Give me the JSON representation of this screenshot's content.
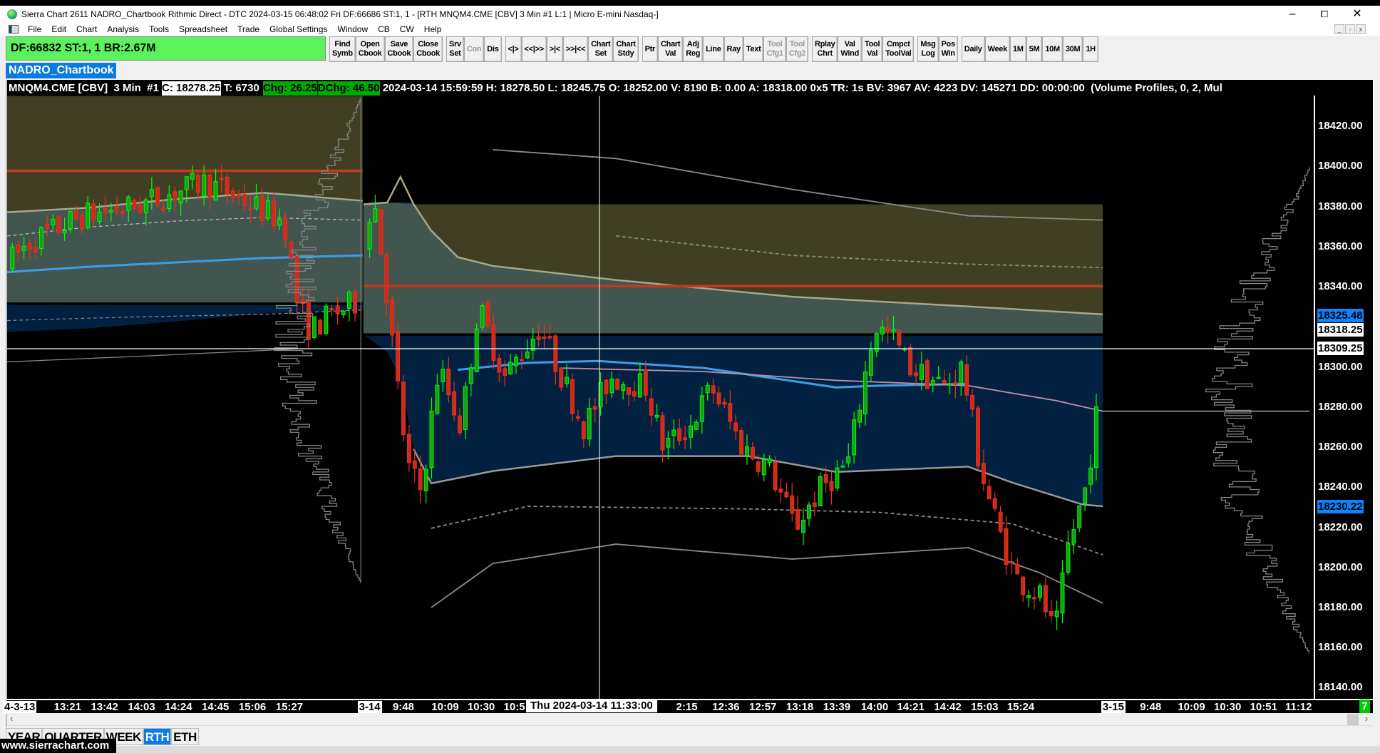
{
  "window": {
    "title": "Sierra Chart 2611 NADRO_Chartbook Rithmic Direct - DTC 2024-03-15  06:48:02 Fri DF:66686  ST:1, 1 - [RTH MNQM4.CME [CBV]  3 Min  #1 L:1 | Micro E-mini Nasdaq-]",
    "minimize": "–",
    "maximize": "⧠",
    "close": "✕"
  },
  "menu": [
    "File",
    "Edit",
    "Chart",
    "Analysis",
    "Tools",
    "Spreadsheet",
    "Trade",
    "Global Settings",
    "Window",
    "CB",
    "CW",
    "Help"
  ],
  "status_box": "DF:66832  ST:1, 1  BR:2.67M",
  "toolbar_groups": [
    [
      {
        "l": "Find\nSymb"
      },
      {
        "l": "Open\nCbook"
      },
      {
        "l": "Save\nCbook"
      },
      {
        "l": "Close\nCbook"
      }
    ],
    [
      {
        "l": "Srv\nSet"
      },
      {
        "l": "Con",
        "disabled": true
      },
      {
        "l": "Dis"
      }
    ],
    [
      {
        "l": "<|>"
      },
      {
        "l": "<<|>>"
      },
      {
        "l": ">|<"
      },
      {
        "l": ">>|<<"
      },
      {
        "l": "Chart\nSet"
      },
      {
        "l": "Chart\nStdy"
      }
    ],
    [
      {
        "l": "Ptr"
      },
      {
        "l": "Chart\nVal"
      },
      {
        "l": "Adj\nReg"
      },
      {
        "l": "Line"
      },
      {
        "l": "Ray"
      },
      {
        "l": "Text"
      },
      {
        "l": "Tool\nCfg1",
        "disabled": true
      },
      {
        "l": "Tool\nCfg2",
        "disabled": true
      }
    ],
    [
      {
        "l": "Rplay\nChrt"
      },
      {
        "l": "Val\nWind"
      },
      {
        "l": "Tool\nVal"
      },
      {
        "l": "Cmpct\nToolVal"
      }
    ],
    [
      {
        "l": "Msg\nLog"
      },
      {
        "l": "Pos\nWin"
      }
    ],
    [
      {
        "l": "Daily"
      },
      {
        "l": "Week"
      },
      {
        "l": "1M"
      },
      {
        "l": "5M"
      },
      {
        "l": "10M"
      },
      {
        "l": "30M"
      },
      {
        "l": "1H"
      }
    ]
  ],
  "chartbook_tab": "NADRO_Chartbook",
  "header": {
    "symbol": "MNQM4.CME [CBV]  3 Min  #1 ",
    "close": "C: 18278.25",
    "trades": " T: 6730 ",
    "chg": "Chg: 26.25",
    "dchg": "DChg: 46.50",
    "rest": " 2024-03-14 15:59:59 H: 18278.50 L: 18245.75 O: 18252.00 V: 8190 B: 0.00 A: 18318.00 0x5 TR: 1s BV: 3967 AV: 4223 DV: 145271 DD: 00:00:00  (Volume Profiles, 0, 2, Mul"
  },
  "price_axis": [
    "18420.00",
    "18400.00",
    "18380.00",
    "18360.00",
    "18340.00",
    "18300.00",
    "18280.00",
    "18260.00",
    "18240.00",
    "18220.00",
    "18200.00",
    "18180.00",
    "18160.00",
    "18140.00"
  ],
  "price_markers": {
    "vwap": "18325.48",
    "ask": "18318.25",
    "cursor": "18309.25",
    "lower": "18230.22"
  },
  "time_axis": [
    "4-3-13",
    "13:21",
    "13:42",
    "14:03",
    "14:24",
    "14:45",
    "15:06",
    "15:27",
    "3-14",
    "9:48",
    "10:09",
    "10:30",
    "10:5",
    "2:15",
    "12:36",
    "12:57",
    "13:18",
    "13:39",
    "14:00",
    "14:21",
    "14:42",
    "15:03",
    "15:24",
    "3-15",
    "9:48",
    "10:09",
    "10:30",
    "10:51",
    "11:12"
  ],
  "cursor_time": "Thu 2024-03-14  11:33:00",
  "corner_badge": "7",
  "period_tabs": [
    "YEAR",
    "QUARTER",
    "WEEK",
    "RTH",
    "ETH"
  ],
  "active_tab": "RTH",
  "watermark": "www.sierrachart.com",
  "colors": {
    "up": "#00ff00",
    "down": "#e8321e",
    "olive": "#403f23",
    "teal": "#43554f",
    "navy": "#02203f",
    "vwap": "#3a9ee8",
    "level": "#c0391e"
  }
}
